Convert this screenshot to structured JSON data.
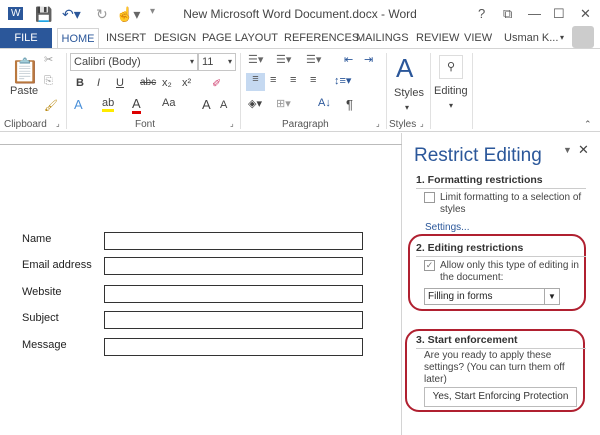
{
  "titlebar": {
    "title": "New Microsoft Word Document.docx - Word",
    "help": "?",
    "restore_ribbon": "⧉",
    "minimize": "—",
    "maximize": "☐",
    "close": "✕"
  },
  "tabs": [
    "FILE",
    "HOME",
    "INSERT",
    "DESIGN",
    "PAGE LAYOUT",
    "REFERENCES",
    "MAILINGS",
    "REVIEW",
    "VIEW"
  ],
  "user": "Usman K...",
  "ribbon": {
    "paste": "Paste",
    "font_name": "Calibri (Body)",
    "font_size": "11",
    "groups": [
      "Clipboard",
      "Font",
      "Paragraph",
      "Styles"
    ],
    "styles": "Styles",
    "editing": "Editing",
    "font_buttons": [
      "B",
      "I",
      "U",
      "abc",
      "x₂",
      "x²"
    ],
    "font_row3": [
      "A",
      "ab",
      "A",
      "Aa",
      "A",
      "A"
    ],
    "para_pilcrow": "¶"
  },
  "form": {
    "fields": [
      "Name",
      "Email address",
      "Website",
      "Subject",
      "Message"
    ]
  },
  "panel": {
    "title": "Restrict Editing",
    "section1": "1. Formatting restrictions",
    "limit_formatting": "Limit formatting to a selection of styles",
    "settings_link": "Settings...",
    "section2": "2. Editing restrictions",
    "allow_only": "Allow only this type of editing in the document:",
    "editing_type": "Filling in forms",
    "section3": "3. Start enforcement",
    "enforce_text": "Are you ready to apply these settings? (You can turn them off later)",
    "enforce_button": "Yes, Start Enforcing Protection"
  },
  "colors": {
    "accent": "#2b579a",
    "highlight": "#b02030"
  }
}
